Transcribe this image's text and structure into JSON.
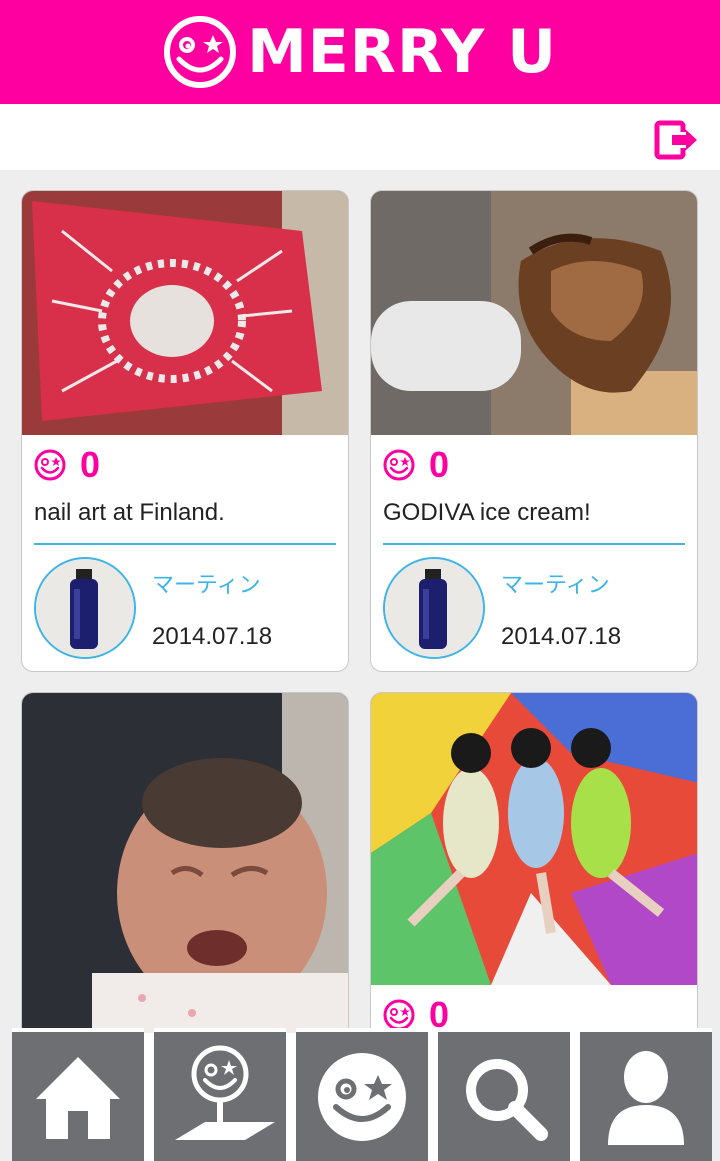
{
  "app": {
    "title": "MERRY U",
    "brand_color": "#ff00a0",
    "accent_color": "#3cb4e6"
  },
  "header": {
    "logo_icon": "smiley-star-logo-icon",
    "logout_icon": "logout-icon"
  },
  "posts": [
    {
      "likes": "0",
      "caption": "nail art at Finland.",
      "author": "マーティン",
      "date": "2014.07.18",
      "photo": "red nail art display board"
    },
    {
      "likes": "0",
      "caption": "GODIVA ice cream!",
      "author": "マーティン",
      "date": "2014.07.18",
      "photo": "chocolate ice cream cone"
    },
    {
      "likes": "",
      "caption": "",
      "author": "",
      "date": "",
      "photo": "crying newborn baby"
    },
    {
      "likes": "0",
      "caption": "",
      "author": "",
      "date": "",
      "photo": "three performers on colorful floor"
    }
  ],
  "tabbar": {
    "tabs": [
      {
        "icon": "home-icon"
      },
      {
        "icon": "map-pin-smiley-icon"
      },
      {
        "icon": "smiley-star-icon"
      },
      {
        "icon": "search-icon"
      },
      {
        "icon": "user-icon"
      }
    ]
  }
}
